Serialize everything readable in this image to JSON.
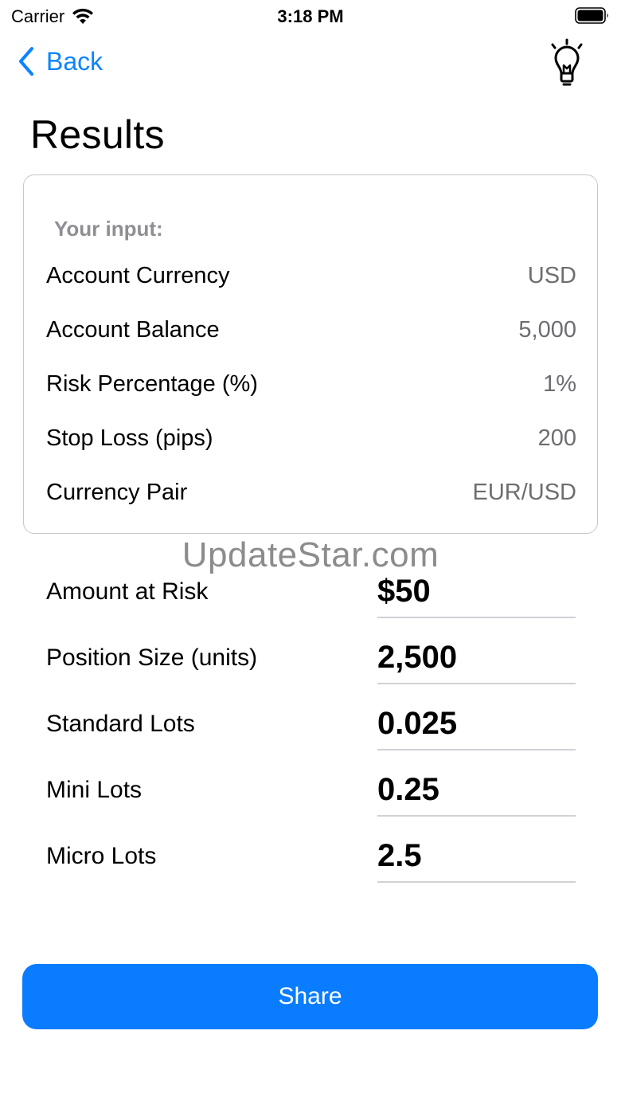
{
  "status_bar": {
    "carrier": "Carrier",
    "time": "3:18 PM",
    "icons": [
      "wifi-icon",
      "battery-icon"
    ]
  },
  "nav": {
    "back_label": "Back",
    "back_icon": "chevron-left-icon",
    "right_icon": "lightbulb-icon"
  },
  "title": "Results",
  "input_card": {
    "heading": "Your input:",
    "rows": [
      {
        "label": "Account Currency",
        "value": "USD"
      },
      {
        "label": "Account Balance",
        "value": "5,000"
      },
      {
        "label": "Risk Percentage (%)",
        "value": "1%"
      },
      {
        "label": "Stop Loss (pips)",
        "value": "200"
      },
      {
        "label": "Currency Pair",
        "value": "EUR/USD"
      }
    ]
  },
  "watermark": "UpdateStar.com",
  "results": [
    {
      "label": "Amount at Risk",
      "value": "$50"
    },
    {
      "label": "Position Size (units)",
      "value": "2,500"
    },
    {
      "label": "Standard Lots",
      "value": "0.025"
    },
    {
      "label": "Mini Lots",
      "value": "0.25"
    },
    {
      "label": "Micro Lots",
      "value": "2.5"
    }
  ],
  "share_label": "Share",
  "colors": {
    "accent": "#0a7cff",
    "secondary_text": "#6d6d72",
    "card_border": "#c7c7cc"
  }
}
